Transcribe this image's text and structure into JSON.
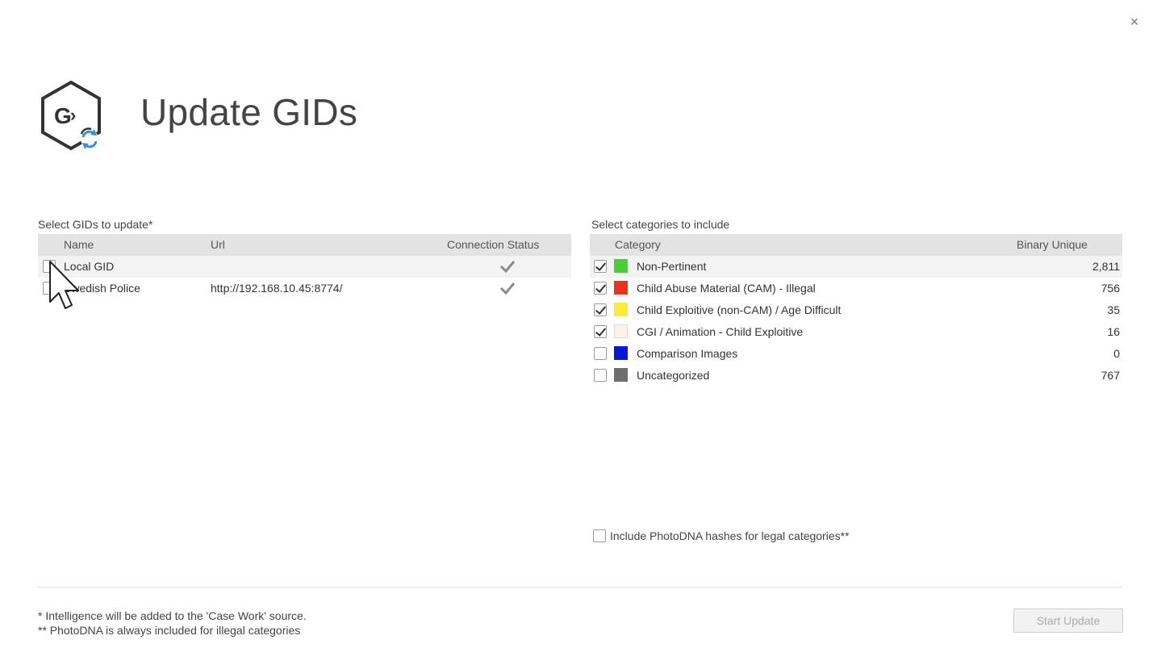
{
  "window": {
    "title": "Update GIDs",
    "close_glyph": "×",
    "logo_icon": "gid-update-logo-icon"
  },
  "gids": {
    "section_label": "Select GIDs to update*",
    "columns": {
      "name": "Name",
      "url": "Url",
      "status": "Connection Status"
    },
    "rows": [
      {
        "name": "Local GID",
        "url": "",
        "checked": false,
        "status_icon": "check-icon"
      },
      {
        "name": "Swedish Police",
        "url": "http://192.168.10.45:8774/",
        "checked": false,
        "status_icon": "check-icon"
      }
    ]
  },
  "categories": {
    "section_label": "Select categories to include",
    "columns": {
      "category": "Category",
      "binary_unique": "Binary Unique"
    },
    "rows": [
      {
        "name": "Non-Pertinent",
        "color": "#4ccc3a",
        "count": "2,811",
        "checked": true
      },
      {
        "name": "Child Abuse Material (CAM) - Illegal",
        "color": "#e8331f",
        "count": "756",
        "checked": true
      },
      {
        "name": "Child Exploitive (non-CAM) / Age Difficult",
        "color": "#fde93a",
        "count": "35",
        "checked": true
      },
      {
        "name": "CGI / Animation - Child Exploitive",
        "color": "#fdf3ea",
        "count": "16",
        "checked": true
      },
      {
        "name": "Comparison Images",
        "color": "#0a17d4",
        "count": "0",
        "checked": false
      },
      {
        "name": "Uncategorized",
        "color": "#6e6e6e",
        "count": "767",
        "checked": false
      }
    ],
    "photodna_label": "Include PhotoDNA hashes for legal categories**",
    "photodna_checked": false
  },
  "footer": {
    "note1": "* Intelligence will be added to the 'Case Work' source.",
    "note2": "** PhotoDNA is always included for illegal categories",
    "start_button": "Start Update"
  }
}
